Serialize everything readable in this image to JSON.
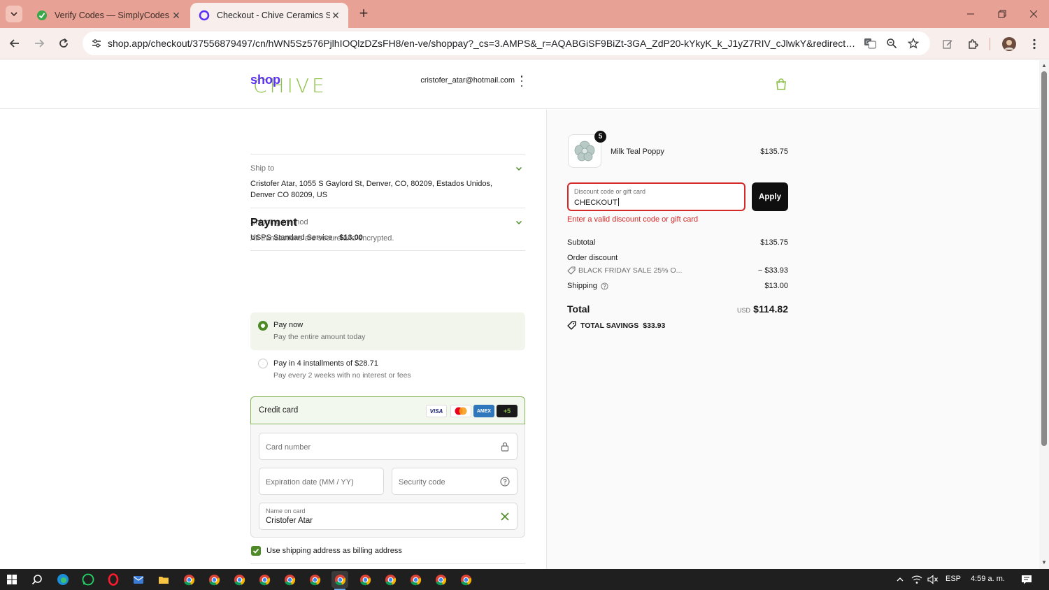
{
  "browser": {
    "tabs": [
      {
        "title": "Verify Codes — SimplyCodes",
        "active": false
      },
      {
        "title": "Checkout - Chive Ceramics Stud",
        "active": true
      }
    ],
    "url": "shop.app/checkout/37556879497/cn/hWN5Sz576PjlhIOQlzDZsFH8/en-ve/shoppay?_cs=3.AMPS&_r=AQABGiSF9BiZt-3GA_ZdP20-kYkyK_k_J1yZ7RIV_cJlwkY&redirect_source=c..."
  },
  "store": {
    "logo_text": "CHIVE",
    "accent": "#8fc14a"
  },
  "account": {
    "brand": "shop",
    "email": "cristofer_atar@hotmail.com"
  },
  "ship_to": {
    "label": "Ship to",
    "line1": "Cristofer Atar, 1055 S Gaylord St, Denver, CO, 80209, Estados Unidos,",
    "line2": "Denver CO 80209, US"
  },
  "shipping_method": {
    "label": "Shipping method",
    "service": "USPS Standard Service ·",
    "price": "$13.00"
  },
  "payment": {
    "title": "Payment",
    "subtitle": "All transactions are secure and encrypted.",
    "options": [
      {
        "title": "Pay now",
        "subtitle": "Pay the entire amount today",
        "selected": true
      },
      {
        "title": "Pay in 4 installments of $28.71",
        "subtitle": "Pay every 2 weeks with no interest or fees",
        "selected": false
      }
    ],
    "credit_card": {
      "title": "Credit card",
      "brands": [
        "VISA",
        "Mastercard",
        "AMEX",
        "+5"
      ],
      "card_number_placeholder": "Card number",
      "expiration_placeholder": "Expiration date (MM / YY)",
      "security_placeholder": "Security code",
      "name_label": "Name on card",
      "name_value": "Cristofer Atar"
    },
    "billing_checkbox": {
      "label": "Use shipping address as billing address",
      "checked": true
    }
  },
  "summary": {
    "product": {
      "name": "Milk Teal Poppy",
      "quantity": "5",
      "price": "$135.75"
    },
    "discount": {
      "label": "Discount code or gift card",
      "value": "CHECKOUT",
      "apply_label": "Apply",
      "error": "Enter a valid discount code or gift card"
    },
    "subtotal_label": "Subtotal",
    "subtotal": "$135.75",
    "order_discount_label": "Order discount",
    "discount_tag": "BLACK FRIDAY SALE 25% O...",
    "discount_amount": "− $33.93",
    "shipping_label": "Shipping",
    "shipping": "$13.00",
    "total_label": "Total",
    "currency": "USD",
    "total": "$114.82",
    "savings_label": "TOTAL SAVINGS",
    "savings": "$33.93"
  },
  "taskbar": {
    "language": "ESP",
    "time": "4:59 a. m."
  }
}
